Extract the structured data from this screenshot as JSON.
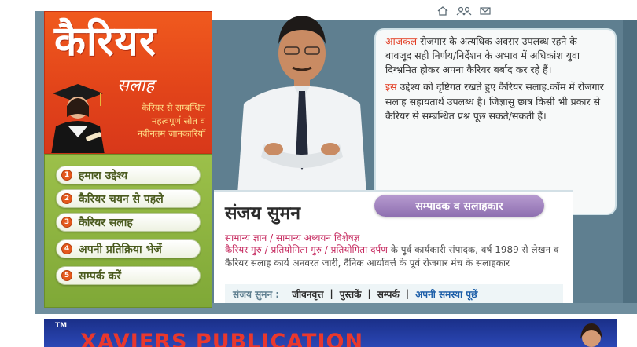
{
  "top_icons": [
    "home-icon",
    "people-icon",
    "mail-icon"
  ],
  "logo": {
    "title": "कैरियर",
    "subtitle": "सलाह",
    "tagline_1": "कैरियर से सम्बन्धित",
    "tagline_2": "महत्वपूर्ण स्रोत व",
    "tagline_3": "नवीनतम जानकारियाँ"
  },
  "nav": {
    "items": [
      {
        "num": "1",
        "label": "हमारा उद्देश्य"
      },
      {
        "num": "2",
        "label": "कैरियर चयन से पहले"
      },
      {
        "num": "3",
        "label": "कैरियर सलाह"
      },
      {
        "num": "4",
        "label": "अपनी प्रतिक्रिया भेजें"
      },
      {
        "num": "5",
        "label": "सम्पर्क करें"
      }
    ]
  },
  "bubble": {
    "p1_highlight": "आजकल",
    "p1_text": " रोजगार के अत्यधिक अवसर उपलब्ध रहने के बावजूद सही निर्णय/निर्देशन के अभाव में अधिकांश युवा दिग्भ्रमित होकर अपना कैरियर बर्बाद कर रहे हैं।",
    "p2_highlight": "इस",
    "p2_text": " उद्देश्य को दृष्टिगत रखते हुए कैरियर सलाह.कॉम में रोजगार सलाह सहायतार्थ उपलब्ध है। जिज्ञासु छात्र किसी भी प्रकार से कैरियर से सम्बन्धित प्रश्न पूछ सकते/सकती हैं।"
  },
  "profile": {
    "name": "संजय सुमन",
    "role": "सम्पादक व सलाहकार",
    "line1": "सामान्य ज्ञान / सामान्य अध्ययन विशेषज्ञ",
    "desc_pink": "कैरियर गुरु / प्रतियोगिता गुरु / प्रतियोगिता दर्पण",
    "desc_rest": " के पूर्व कार्यकारी संपादक, वर्ष 1989 से लेखन व कैरियर सलाह कार्य अनवरत जारी, दैनिक आर्यावर्त्त के पूर्व रोजगार मंच के सलाहकार",
    "links_label": "संजय सुमन :",
    "links": [
      "जीवनवृत्त",
      "पुस्तकें",
      "सम्पर्क",
      "अपनी समस्या पूछें"
    ]
  },
  "banner": {
    "tm": "TM",
    "text": "XAVIERS PUBLICATION"
  },
  "colors": {
    "logo_orange": "#e2441a",
    "nav_green": "#8cb440",
    "backdrop_blue": "#5f7f90",
    "role_purple": "#8e6fb0",
    "banner_blue": "#22399e"
  }
}
